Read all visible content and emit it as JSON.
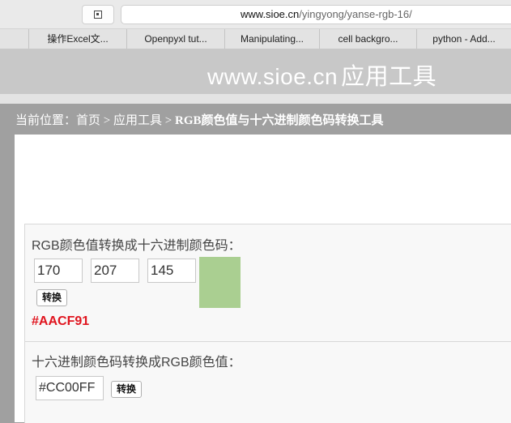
{
  "browser": {
    "url_host": "www.sioe.cn",
    "url_path": "/yingyong/yanse-rgb-16/",
    "bookmarks": [
      "",
      "操作Excel文...",
      "Openpyxl tut...",
      "Manipulating...",
      "cell backgro...",
      "python - Add..."
    ]
  },
  "site": {
    "title_en": "www.sioe.cn",
    "title_cn": "应用工具"
  },
  "breadcrumb": {
    "prefix": "当前位置：",
    "home": "首页",
    "sep1": " > ",
    "section": "应用工具",
    "sep2": " > ",
    "current": "RGB颜色值与十六进制颜色码转换工具"
  },
  "rgb_to_hex": {
    "heading": "RGB颜色值转换成十六进制颜色码：",
    "r": "170",
    "g": "207",
    "b": "145",
    "swatch_color": "#aacf91",
    "convert_label": "转换",
    "result": "#AACF91"
  },
  "hex_to_rgb": {
    "heading": "十六进制颜色码转换成RGB颜色值：",
    "hex_value": "#CC00FF",
    "convert_label": "转换"
  },
  "colors": {
    "result_text": "#e0141e",
    "header_bg": "#c8c8c8"
  }
}
